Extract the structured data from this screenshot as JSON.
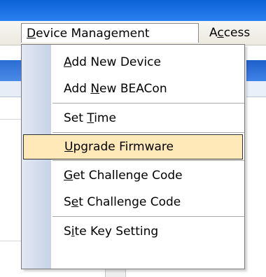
{
  "menubar": {
    "active_menu": {
      "pre": "",
      "acc": "D",
      "post": "evice Management"
    },
    "next_menu": {
      "pre": "A",
      "acc": "c",
      "post": "cess"
    }
  },
  "menu": {
    "items": [
      {
        "pre": "",
        "acc": "A",
        "post": "dd New Device"
      },
      {
        "pre": "Add ",
        "acc": "N",
        "post": "ew BEACon"
      },
      {
        "pre": "Set ",
        "acc": "T",
        "post": "ime"
      },
      {
        "pre": "",
        "acc": "U",
        "post": "pgrade Firmware",
        "highlighted": true
      },
      {
        "pre": "",
        "acc": "G",
        "post": "et Challenge Code"
      },
      {
        "pre": "S",
        "acc": "e",
        "post": "t Challenge Code"
      },
      {
        "pre": "S",
        "acc": "i",
        "post": "te Key Setting"
      }
    ]
  },
  "colors": {
    "highlight": "#ffe9b8",
    "titlebar": "#1f74e6",
    "gutter": "#c7d3e7"
  }
}
